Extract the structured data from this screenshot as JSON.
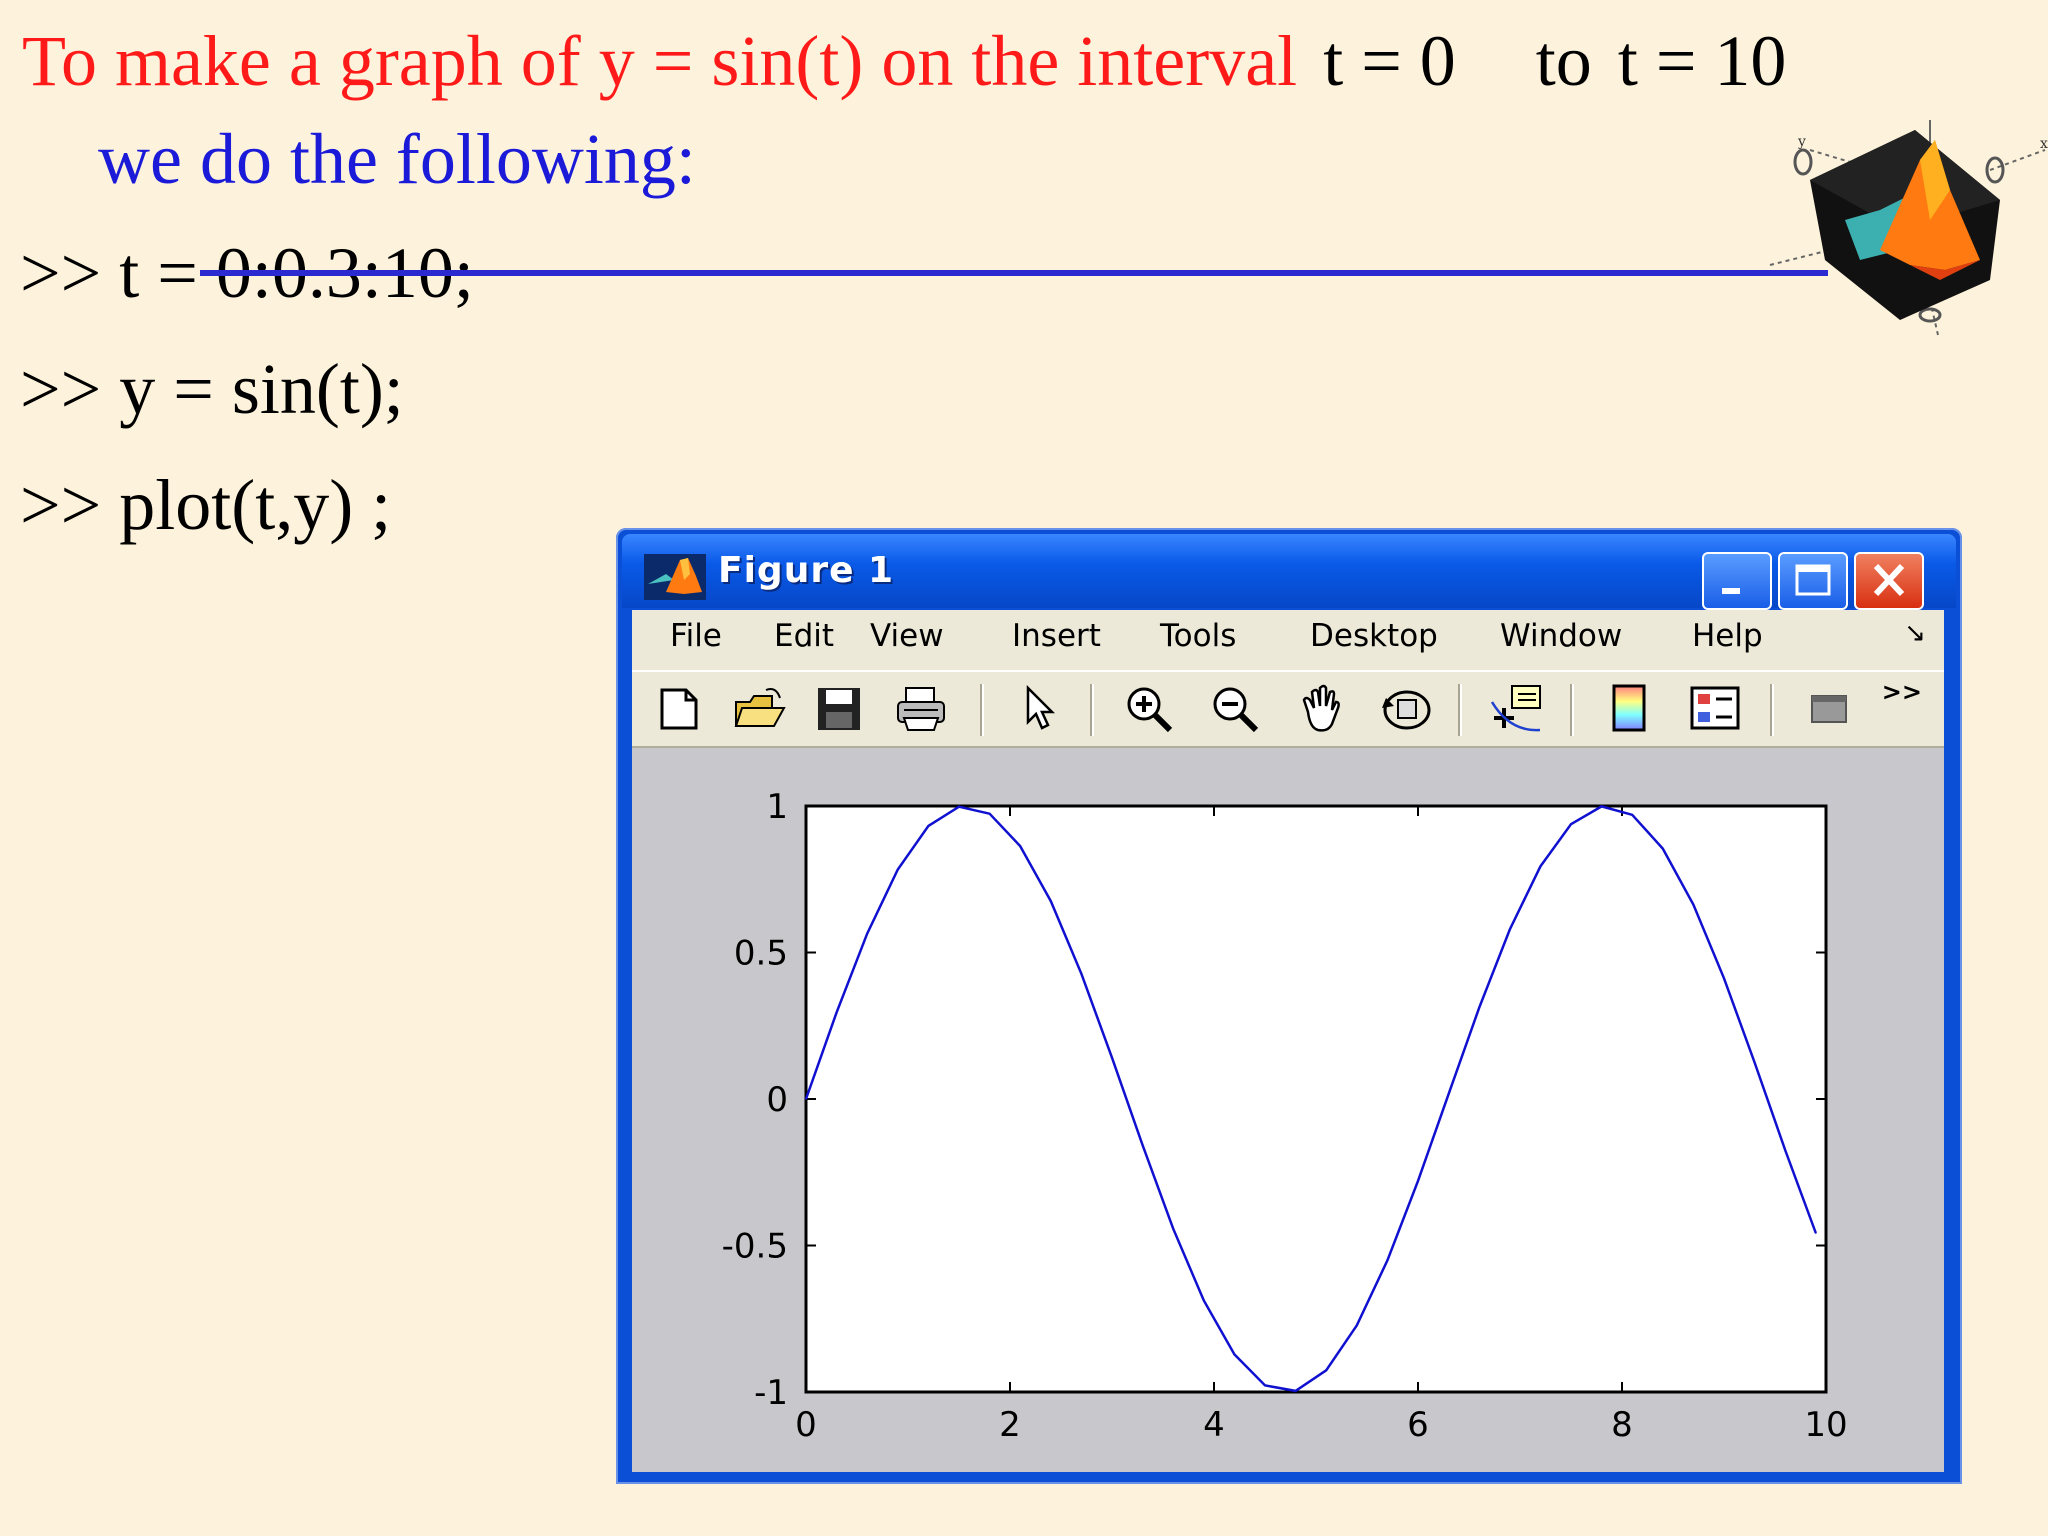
{
  "slide": {
    "title_red": "To make a graph of y = sin(t) on the interval",
    "title_t0": "t = 0",
    "title_to": "to",
    "title_t10": "t = 10",
    "subtitle": "we do the following:",
    "code": [
      ">> t = 0:0.3:10;",
      ">> y = sin(t);",
      ">> plot(t,y) ;"
    ]
  },
  "colors": {
    "title_red": "#ff1a1a",
    "subtitle_blue": "#1a1ad8",
    "background": "#fdf3dc",
    "window_blue": "#0b4fd6",
    "plot_line": "#1010d0"
  },
  "window": {
    "title": "Figure 1",
    "menu": [
      "File",
      "Edit",
      "View",
      "Insert",
      "Tools",
      "Desktop",
      "Window",
      "Help"
    ],
    "toolbar": [
      "new-file-icon",
      "open-folder-icon",
      "save-icon",
      "print-icon",
      "select-arrow-icon",
      "zoom-in-icon",
      "zoom-out-icon",
      "pan-hand-icon",
      "rotate-3d-icon",
      "data-cursor-icon",
      "colorbar-icon",
      "legend-icon",
      "plot-tools-icon"
    ]
  },
  "chart_data": {
    "type": "line",
    "x_start": 0,
    "x_step": 0.3,
    "x_end": 10,
    "function": "sin",
    "xlim": [
      0,
      10
    ],
    "ylim": [
      -1,
      1
    ],
    "xticks": [
      "0",
      "2",
      "4",
      "6",
      "8",
      "10"
    ],
    "yticks": [
      "1",
      "0.5",
      "0",
      "-0.5",
      "-1"
    ],
    "grid": false,
    "series": [
      {
        "color": "#1010d0",
        "x": [
          0,
          0.3,
          0.6,
          0.9,
          1.2,
          1.5,
          1.8,
          2.1,
          2.4,
          2.7,
          3.0,
          3.3,
          3.6,
          3.9,
          4.2,
          4.5,
          4.8,
          5.1,
          5.4,
          5.7,
          6.0,
          6.3,
          6.6,
          6.9,
          7.2,
          7.5,
          7.8,
          8.1,
          8.4,
          8.7,
          9.0,
          9.3,
          9.6,
          9.9
        ],
        "y": [
          0,
          0.2955,
          0.5646,
          0.7833,
          0.932,
          0.9975,
          0.9738,
          0.8632,
          0.6755,
          0.4274,
          0.1411,
          -0.1577,
          -0.4425,
          -0.6878,
          -0.8716,
          -0.9775,
          -0.9962,
          -0.9258,
          -0.7728,
          -0.5507,
          -0.2794,
          0.0168,
          0.3115,
          0.5784,
          0.7937,
          0.938,
          0.9985,
          0.9699,
          0.8546,
          0.663,
          0.4121,
          0.1245,
          -0.1743,
          -0.4575
        ]
      }
    ]
  }
}
